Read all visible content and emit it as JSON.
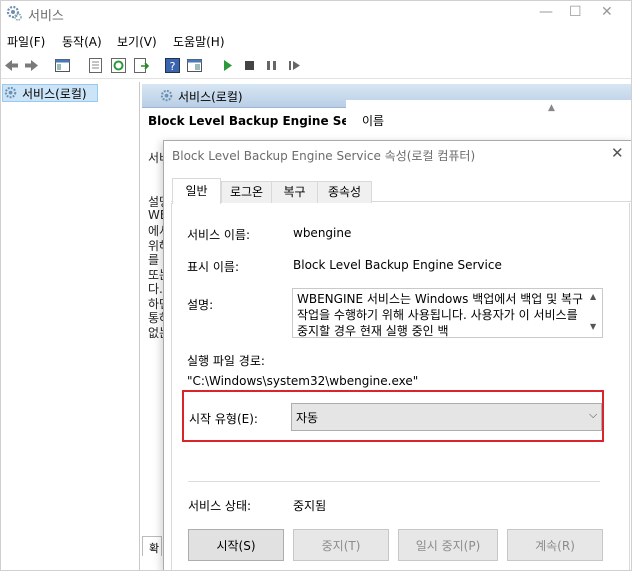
{
  "window": {
    "title": "서비스",
    "menu": [
      "파일(F)",
      "동작(A)",
      "보기(V)",
      "도움말(H)"
    ]
  },
  "tree": {
    "item": "서비스(로컬)"
  },
  "right_pane": {
    "header": "서비스(로컬)",
    "service_title": "Block Level Backup Engine Service",
    "column_name": "이름",
    "left_fragments": [
      "서비",
      "설명",
      "WB",
      "에서",
      "위해",
      "를",
      "또는",
      "다.",
      "하면",
      "통하",
      "없는"
    ],
    "bottom_tab": "확"
  },
  "dialog": {
    "title": "Block Level Backup Engine Service 속성(로컬 컴퓨터)",
    "tabs": [
      "일반",
      "로그온",
      "복구",
      "종속성"
    ],
    "service_name_label": "서비스 이름:",
    "service_name_value": "wbengine",
    "display_name_label": "표시 이름:",
    "display_name_value": "Block Level Backup Engine Service",
    "description_label": "설명:",
    "description_value": "WBENGINE 서비스는 Windows 백업에서 백업 및 복구 작업을 수행하기 위해 사용됩니다. 사용자가 이 서비스를 중지할 경우 현재 실행 중인 백",
    "exe_path_label": "실행 파일 경로:",
    "exe_path_value": "\"C:\\Windows\\system32\\wbengine.exe\"",
    "startup_type_label": "시작 유형(E):",
    "startup_type_value": "자동",
    "service_status_label": "서비스 상태:",
    "service_status_value": "중지됨",
    "buttons": {
      "start": "시작(S)",
      "stop": "중지(T)",
      "pause": "일시 중지(P)",
      "resume": "계속(R)"
    }
  },
  "colors": {
    "highlight_box": "#d8242a",
    "header_gradient": "#b9cfe6",
    "selection": "#cce4f7"
  }
}
